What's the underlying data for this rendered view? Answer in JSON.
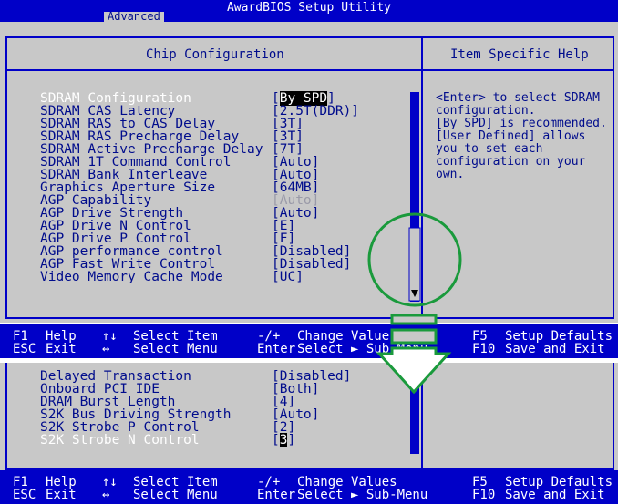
{
  "title": "AwardBIOS Setup Utility",
  "menu": {
    "active_tab": "Advanced"
  },
  "main": {
    "header_left": "Chip Configuration",
    "header_right": "Item Specific Help",
    "items": [
      {
        "label": "SDRAM Configuration",
        "value_open": "[",
        "value_hl": "By SPD",
        "value_close": "]"
      },
      {
        "label": "SDRAM CAS Latency",
        "value": "[2.5T(DDR)]"
      },
      {
        "label": "SDRAM RAS to CAS Delay",
        "value": "[3T]"
      },
      {
        "label": "SDRAM RAS Precharge Delay",
        "value": "[3T]"
      },
      {
        "label": "SDRAM Active Precharge Delay",
        "value": "[7T]"
      },
      {
        "label": "SDRAM 1T Command Control",
        "value": "[Auto]"
      },
      {
        "label": "SDRAM Bank Interleave",
        "value": "[Auto]"
      },
      {
        "label": "Graphics Aperture Size",
        "value": "[64MB]"
      },
      {
        "label": "AGP Capability",
        "value": "[Auto]"
      },
      {
        "label": "AGP Drive Strength",
        "value": "[Auto]"
      },
      {
        "label": "AGP Drive N Control",
        "value": "[E]"
      },
      {
        "label": "AGP Drive P Control",
        "value": "[F]"
      },
      {
        "label": "AGP performance control",
        "value": "[Disabled]"
      },
      {
        "label": "AGP Fast Write Control",
        "value": "[Disabled]"
      },
      {
        "label": "Video Memory Cache Mode",
        "value": "[UC]"
      }
    ],
    "help_lines": [
      "<Enter> to select SDRAM",
      "configuration.",
      "[By SPD] is recommended.",
      "[User Defined] allows",
      "you to set each",
      "configuration on your",
      "own."
    ]
  },
  "scrolled": {
    "items": [
      {
        "label": "Delayed Transaction",
        "value": "[Disabled]"
      },
      {
        "label": "Onboard PCI IDE",
        "value": "[Both]"
      },
      {
        "label": "DRAM Burst Length",
        "value": "[4]"
      },
      {
        "label": "S2K Bus Driving Strength",
        "value": "[Auto]"
      },
      {
        "label": "S2K Strobe P Control",
        "value": "[2]"
      },
      {
        "label": "S2K Strobe N Control",
        "value_open": "[",
        "value_hl": "3",
        "value_close": "]"
      }
    ]
  },
  "footer": {
    "f1_key": "F1",
    "f1_text": "Help",
    "ud_key": "↑↓",
    "ud_text": "Select Item",
    "pm_key": "-/+",
    "pm_text": "Change Values",
    "f5_key": "F5",
    "f5_text": "Setup Defaults",
    "esc_key": "ESC",
    "esc_text": "Exit",
    "lr_key": "↔",
    "lr_text": "Select Menu",
    "enter_key": "Enter",
    "enter_text": "Select ► Sub-Menu",
    "f10_key": "F10",
    "f10_text": "Save and Exit"
  },
  "colors": {
    "bios_blue": "#0000c8",
    "bios_gray": "#c8c8c8",
    "annotation_green": "#1a9a3c"
  },
  "annotation_icons": [
    "scroll-magnifier-circle-icon",
    "scroll-down-arrow-icon"
  ]
}
